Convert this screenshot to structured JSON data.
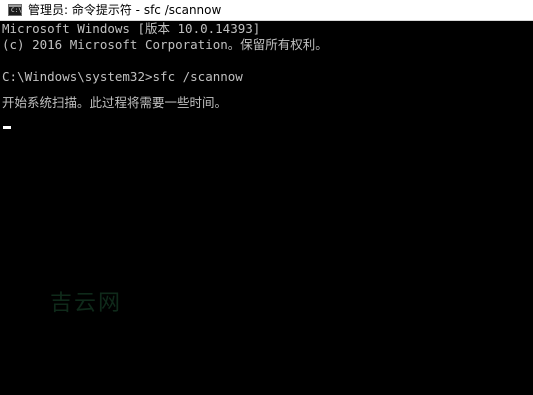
{
  "window": {
    "title": "管理员: 命令提示符 - sfc  /scannow",
    "icon_name": "cmd-icon",
    "icon_text": "C:\\",
    "colors": {
      "titlebar_background": "#ffffff",
      "console_background": "#000000",
      "console_text": "#c0c0c0"
    }
  },
  "console": {
    "lines": [
      "Microsoft Windows [版本 10.0.14393]",
      "(c) 2016 Microsoft Corporation。保留所有权利。",
      "",
      "C:\\Windows\\system32>sfc /scannow",
      "",
      "开始系统扫描。此过程将需要一些时间。"
    ]
  },
  "watermark": {
    "text": "吉云网"
  }
}
